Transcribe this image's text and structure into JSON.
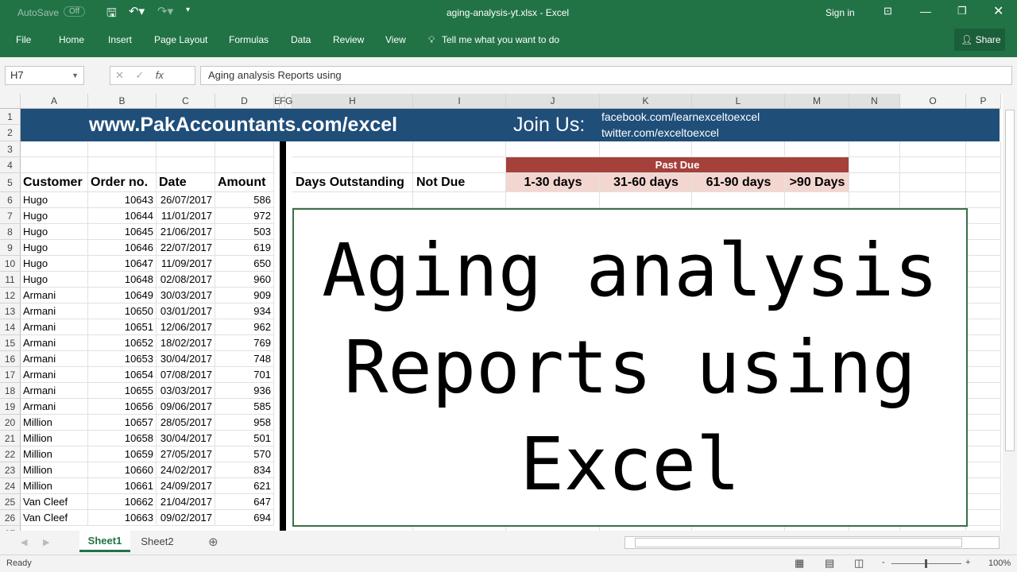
{
  "titlebar": {
    "autosave": "AutoSave",
    "autosave_state": "Off",
    "title": "aging-analysis-yt.xlsx  -  Excel",
    "signin": "Sign in"
  },
  "ribbon": {
    "tabs": [
      "File",
      "Home",
      "Insert",
      "Page Layout",
      "Formulas",
      "Data",
      "Review",
      "View"
    ],
    "tell_me": "Tell me what you want to do",
    "share": "Share"
  },
  "formula_bar": {
    "name_box": "H7",
    "fx": "fx",
    "formula": "Aging analysis Reports using"
  },
  "columns": [
    "A",
    "B",
    "C",
    "D",
    "E",
    "F",
    "G",
    "H",
    "I",
    "J",
    "K",
    "L",
    "M",
    "N",
    "O",
    "P"
  ],
  "banner": {
    "site": "www.PakAccountants.com/excel",
    "join": "Join Us:",
    "facebook": "facebook.com/learnexceltoexcel",
    "twitter": "twitter.com/exceltoexcel"
  },
  "headers": {
    "customer": "Customer",
    "order": "Order no.",
    "date": "Date",
    "amount": "Amount",
    "days_outstanding": "Days Outstanding",
    "not_due": "Not Due",
    "past_due": "Past Due",
    "b1": "1-30 days",
    "b2": "31-60 days",
    "b3": "61-90 days",
    "b4": ">90 Days"
  },
  "rows": [
    [
      "Hugo",
      "10643",
      "26/07/2017",
      "586"
    ],
    [
      "Hugo",
      "10644",
      "11/01/2017",
      "972"
    ],
    [
      "Hugo",
      "10645",
      "21/06/2017",
      "503"
    ],
    [
      "Hugo",
      "10646",
      "22/07/2017",
      "619"
    ],
    [
      "Hugo",
      "10647",
      "11/09/2017",
      "650"
    ],
    [
      "Hugo",
      "10648",
      "02/08/2017",
      "960"
    ],
    [
      "Armani",
      "10649",
      "30/03/2017",
      "909"
    ],
    [
      "Armani",
      "10650",
      "03/01/2017",
      "934"
    ],
    [
      "Armani",
      "10651",
      "12/06/2017",
      "962"
    ],
    [
      "Armani",
      "10652",
      "18/02/2017",
      "769"
    ],
    [
      "Armani",
      "10653",
      "30/04/2017",
      "748"
    ],
    [
      "Armani",
      "10654",
      "07/08/2017",
      "701"
    ],
    [
      "Armani",
      "10655",
      "03/03/2017",
      "936"
    ],
    [
      "Armani",
      "10656",
      "09/06/2017",
      "585"
    ],
    [
      "Million",
      "10657",
      "28/05/2017",
      "958"
    ],
    [
      "Million",
      "10658",
      "30/04/2017",
      "501"
    ],
    [
      "Million",
      "10659",
      "27/05/2017",
      "570"
    ],
    [
      "Million",
      "10660",
      "24/02/2017",
      "834"
    ],
    [
      "Million",
      "10661",
      "24/09/2017",
      "621"
    ],
    [
      "Van Cleef",
      "10662",
      "21/04/2017",
      "647"
    ],
    [
      "Van Cleef",
      "10663",
      "09/02/2017",
      "694"
    ]
  ],
  "textbox": {
    "line1": "Aging analysis",
    "line2": "Reports using",
    "line3": "Excel"
  },
  "sheets": [
    "Sheet1",
    "Sheet2"
  ],
  "status": {
    "ready": "Ready",
    "zoom": "100%"
  },
  "colors": {
    "excel_green": "#217346",
    "banner": "#1f4e79",
    "past_due": "#a5403a",
    "bucket_bg": "#f4d6d0"
  }
}
